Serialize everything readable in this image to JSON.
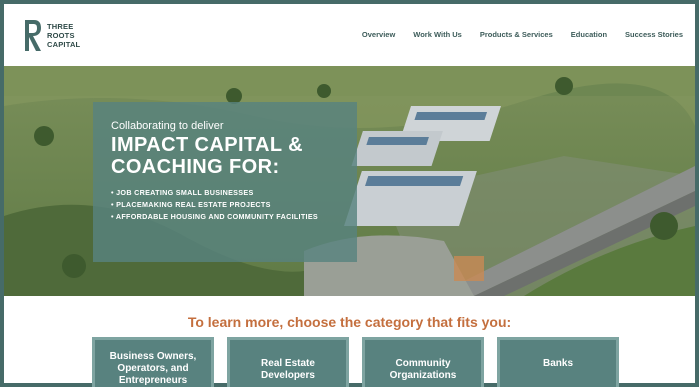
{
  "brand": {
    "line1": "THREE",
    "line2": "ROOTS",
    "line3": "CAPITAL"
  },
  "nav": {
    "items": [
      "Overview",
      "Work With Us",
      "Products & Services",
      "Education",
      "Success Stories"
    ]
  },
  "hero": {
    "kicker": "Collaborating to deliver",
    "title_line1": "IMPACT CAPITAL &",
    "title_line2": "COACHING FOR:",
    "bullets": [
      "JOB CREATING SMALL BUSINESSES",
      "PLACEMAKING REAL ESTATE PROJECTS",
      "AFFORDABLE HOUSING AND COMMUNITY FACILITIES"
    ]
  },
  "categories": {
    "heading": "To learn more, choose the category that fits you:",
    "items": [
      {
        "line1": "Business Owners,",
        "line2": "Operators, and",
        "line3": "Entrepreneurs"
      },
      {
        "line1": "Real Estate",
        "line2": "Developers"
      },
      {
        "line1": "Community",
        "line2": "Organizations"
      },
      {
        "line1": "Banks"
      }
    ]
  },
  "colors": {
    "frame": "#466b68",
    "brand_text": "#2f4a48",
    "overlay": "#58827f",
    "heading_accent": "#c46f3e",
    "category_bg": "#58827f"
  },
  "icons": {
    "logo": "stylized-R-logo"
  }
}
